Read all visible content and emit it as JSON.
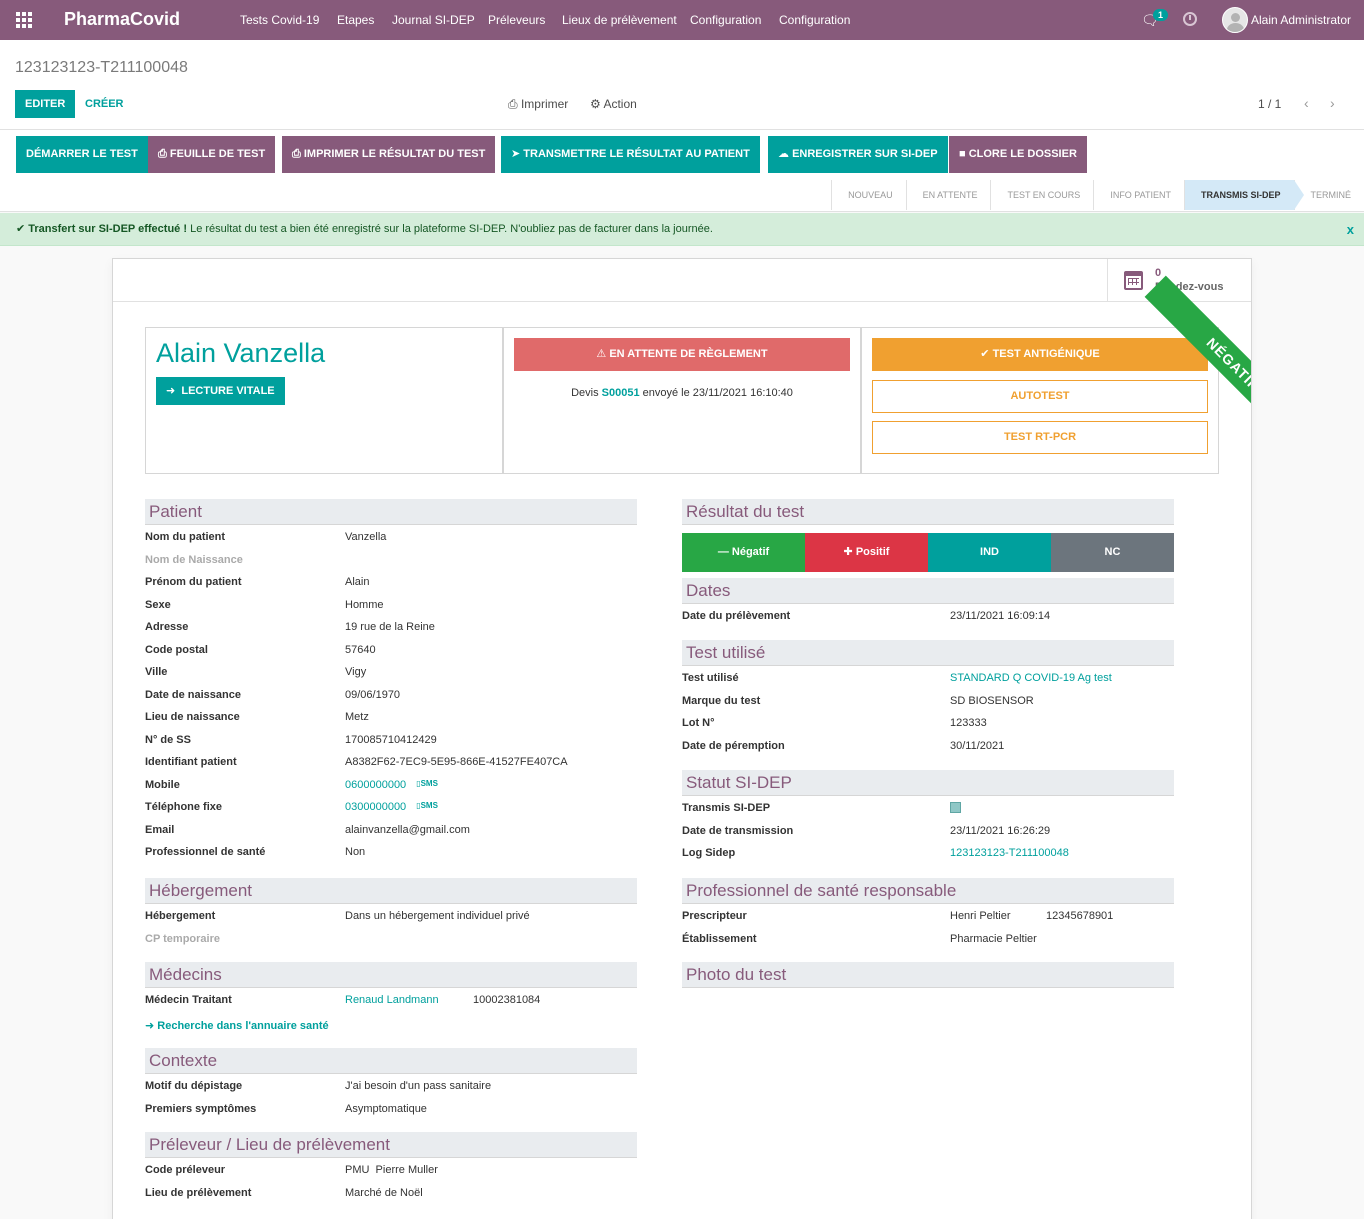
{
  "nav": {
    "brand": "PharmaCovid",
    "menu": [
      "Tests Covid-19",
      "Etapes",
      "Journal SI-DEP",
      "Préleveurs",
      "Lieux de prélèvement",
      "Configuration",
      "Configuration"
    ],
    "chat_count": "1",
    "user": "Alain Administrator"
  },
  "control": {
    "title": "123123123-T211100048",
    "edit": "EDITER",
    "create": "CRÉER",
    "print": "Imprimer",
    "action": "Action",
    "pager": "1 / 1"
  },
  "header_buttons": [
    "DÉMARRER LE TEST",
    "FEUILLE DE TEST",
    "IMPRIMER LE RÉSULTAT DU TEST",
    "TRANSMETTRE LE RÉSULTAT AU PATIENT",
    "ENREGISTRER SUR SI-DEP",
    "CLORE LE DOSSIER"
  ],
  "stages": [
    "NOUVEAU",
    "EN ATTENTE",
    "TEST EN COURS",
    "INFO PATIENT",
    "TRANSMIS SI-DEP",
    "TERMINÉ"
  ],
  "active_stage": "TRANSMIS SI-DEP",
  "alert": {
    "title": "Transfert sur SI-DEP effectué !",
    "text": " Le résultat du test a bien été enregistré sur la plateforme SI-DEP. N'oubliez pas de facturer dans la journée.",
    "close": "x"
  },
  "smart": {
    "count": "0",
    "label": "Rendez-vous"
  },
  "ribbon": "NÉGATIF",
  "patient_card": {
    "name": "Alain Vanzella",
    "vitale": "LECTURE VITALE"
  },
  "payment_card": {
    "status": "EN ATTENTE DE RÈGLEMENT",
    "devis_prefix": "Devis ",
    "devis_ref": "S00051",
    "devis_suffix": " envoyé le 23/11/2021 16:10:40"
  },
  "test_type": {
    "selected": "TEST ANTIGÉNIQUE",
    "options": [
      "AUTOTEST",
      "TEST RT-PCR"
    ]
  },
  "patient": {
    "title": "Patient",
    "rows": [
      {
        "label": "Nom du patient",
        "value": "Vanzella"
      },
      {
        "label": "Nom de Naissance",
        "value": ""
      },
      {
        "label": "Prénom du patient",
        "value": "Alain"
      },
      {
        "label": "Sexe",
        "value": "Homme"
      },
      {
        "label": "Adresse",
        "value": "19 rue de la Reine"
      },
      {
        "label": "Code postal",
        "value": "57640"
      },
      {
        "label": "Ville",
        "value": "Vigy"
      },
      {
        "label": "Date de naissance",
        "value": "09/06/1970"
      },
      {
        "label": "Lieu de naissance",
        "value": "Metz"
      },
      {
        "label": "N° de SS",
        "value": "170085710412429"
      },
      {
        "label": "Identifiant patient",
        "value": "A8382F62-7EC9-5E95-866E-41527FE407CA"
      },
      {
        "label": "Mobile",
        "value": "0600000000"
      },
      {
        "label": "Téléphone fixe",
        "value": "0300000000"
      },
      {
        "label": "Email",
        "value": "alainvanzella@gmail.com"
      },
      {
        "label": "Professionnel de santé",
        "value": "Non"
      }
    ],
    "sms": "SMS"
  },
  "hebergement": {
    "title": "Hébergement",
    "rows": [
      {
        "label": "Hébergement",
        "value": "Dans un hébergement individuel privé"
      },
      {
        "label": "CP temporaire",
        "value": ""
      }
    ]
  },
  "medecins": {
    "title": "Médecins",
    "label": "Médecin Traitant",
    "name": "Renaud Landmann",
    "id": "10002381084",
    "annuaire": "Recherche dans l'annuaire santé"
  },
  "contexte": {
    "title": "Contexte",
    "rows": [
      {
        "label": "Motif du dépistage",
        "value": "J'ai besoin d'un pass sanitaire"
      },
      {
        "label": "Premiers symptômes",
        "value": "Asymptomatique"
      }
    ]
  },
  "preleveur": {
    "title": "Préleveur / Lieu de prélèvement",
    "rows": [
      {
        "label": "Code préleveur",
        "value": "PMU  Pierre Muller"
      },
      {
        "label": "Lieu de prélèvement",
        "value": "Marché de Noël"
      }
    ]
  },
  "resultat": {
    "title": "Résultat du test",
    "buttons": [
      "Négatif",
      "Positif",
      "IND",
      "NC"
    ],
    "colors": [
      "#28a745",
      "#dc3545",
      "#00a09d",
      "#6c757d"
    ]
  },
  "dates": {
    "title": "Dates",
    "rows": [
      {
        "label": "Date du prélèvement",
        "value": "23/11/2021 16:09:14"
      }
    ]
  },
  "test_utilise": {
    "title": "Test utilisé",
    "rows": [
      {
        "label": "Test utilisé",
        "value": "STANDARD Q COVID-19 Ag test"
      },
      {
        "label": "Marque du test",
        "value": "SD BIOSENSOR"
      },
      {
        "label": "Lot N°",
        "value": "123333"
      },
      {
        "label": "Date de péremption",
        "value": "30/11/2021"
      }
    ]
  },
  "sidep": {
    "title": "Statut SI-DEP",
    "rows": [
      {
        "label": "Transmis SI-DEP",
        "value": ""
      },
      {
        "label": "Date de transmission",
        "value": "23/11/2021 16:26:29"
      },
      {
        "label": "Log Sidep",
        "value": "123123123-T211100048"
      }
    ]
  },
  "professionnel": {
    "title": "Professionnel de santé responsable",
    "rows": [
      {
        "label": "Prescripteur",
        "value": "Henri Peltier",
        "value2": "12345678901"
      },
      {
        "label": "Établissement",
        "value": "Pharmacie Peltier"
      }
    ]
  },
  "photo": {
    "title": "Photo du test"
  }
}
